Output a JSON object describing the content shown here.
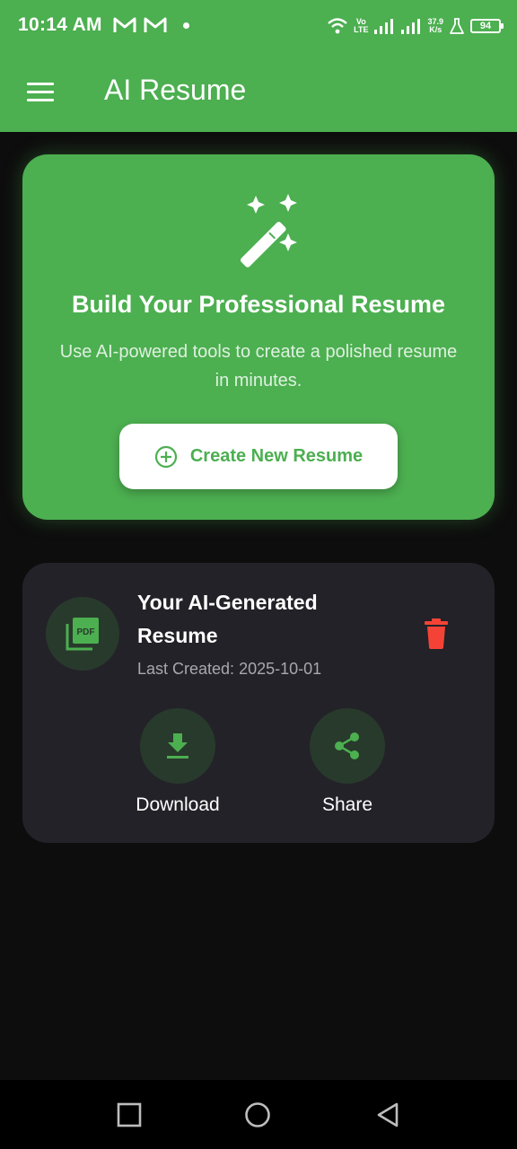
{
  "status_bar": {
    "time": "10:14 AM",
    "volte_top": "Vo",
    "volte_bottom": "LTE",
    "speed_value": "37.9",
    "speed_unit": "K/s",
    "battery": "94"
  },
  "app_bar": {
    "title": "AI Resume",
    "menu_icon": "hamburger-menu-icon"
  },
  "hero": {
    "icon": "magic-wand-icon",
    "title": "Build Your Professional Resume",
    "subtitle": "Use AI-powered tools to create a polished resume in minutes.",
    "button_icon": "add-circle-icon",
    "button_label": "Create New Resume"
  },
  "resume_card": {
    "icon": "pdf-icon",
    "title": "Your AI-Generated Resume",
    "date_label": "Last Created: 2025-10-01",
    "delete_icon": "trash-icon",
    "actions": [
      {
        "icon": "download-icon",
        "label": "Download"
      },
      {
        "icon": "share-icon",
        "label": "Share"
      }
    ]
  },
  "nav_bar": {
    "buttons": [
      "recents-square-icon",
      "home-circle-icon",
      "back-triangle-icon"
    ]
  },
  "colors": {
    "accent_green": "#4caf50",
    "background": "#0d0d0d",
    "card": "#232228",
    "delete_red": "#f44336"
  }
}
